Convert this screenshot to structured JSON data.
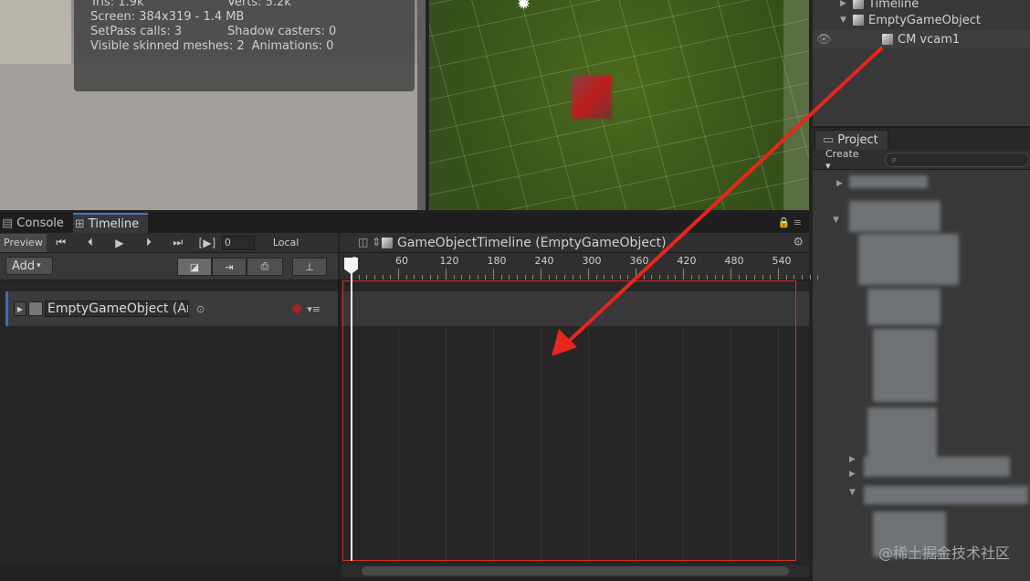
{
  "stats": {
    "tris": "Tris: 1.9k",
    "verts": "Verts: 5.2k",
    "screen": "Screen: 384x319 - 1.4 MB",
    "setpass": "SetPass calls: 3",
    "shadow": "Shadow casters: 0",
    "skinned": "Visible skinned meshes: 2",
    "animations": "Animations: 0"
  },
  "hierarchy": {
    "items": [
      {
        "label": "Timeline"
      },
      {
        "label": "EmptyGameObject"
      },
      {
        "label": "CM vcam1"
      }
    ]
  },
  "project": {
    "tab_label": "Project",
    "create_label": "Create",
    "search_placeholder": "⌕"
  },
  "tabs": [
    {
      "label": "Console"
    },
    {
      "label": "Timeline"
    }
  ],
  "toolbar": {
    "preview_label": "Preview",
    "frame_value": "0",
    "local_label": "Local",
    "add_label": "Add"
  },
  "timeline": {
    "title": "GameObjectTimeline (EmptyGameObject)",
    "track_name": "EmptyGameObject (Ar",
    "ruler_labels": [
      "0",
      "60",
      "120",
      "180",
      "240",
      "300",
      "360",
      "420",
      "480",
      "540"
    ]
  },
  "watermark": "@稀土掘金技术社区",
  "colors": {
    "accent": "#3c78c0",
    "annotation_red": "#e8261e",
    "record": "#a82020"
  }
}
